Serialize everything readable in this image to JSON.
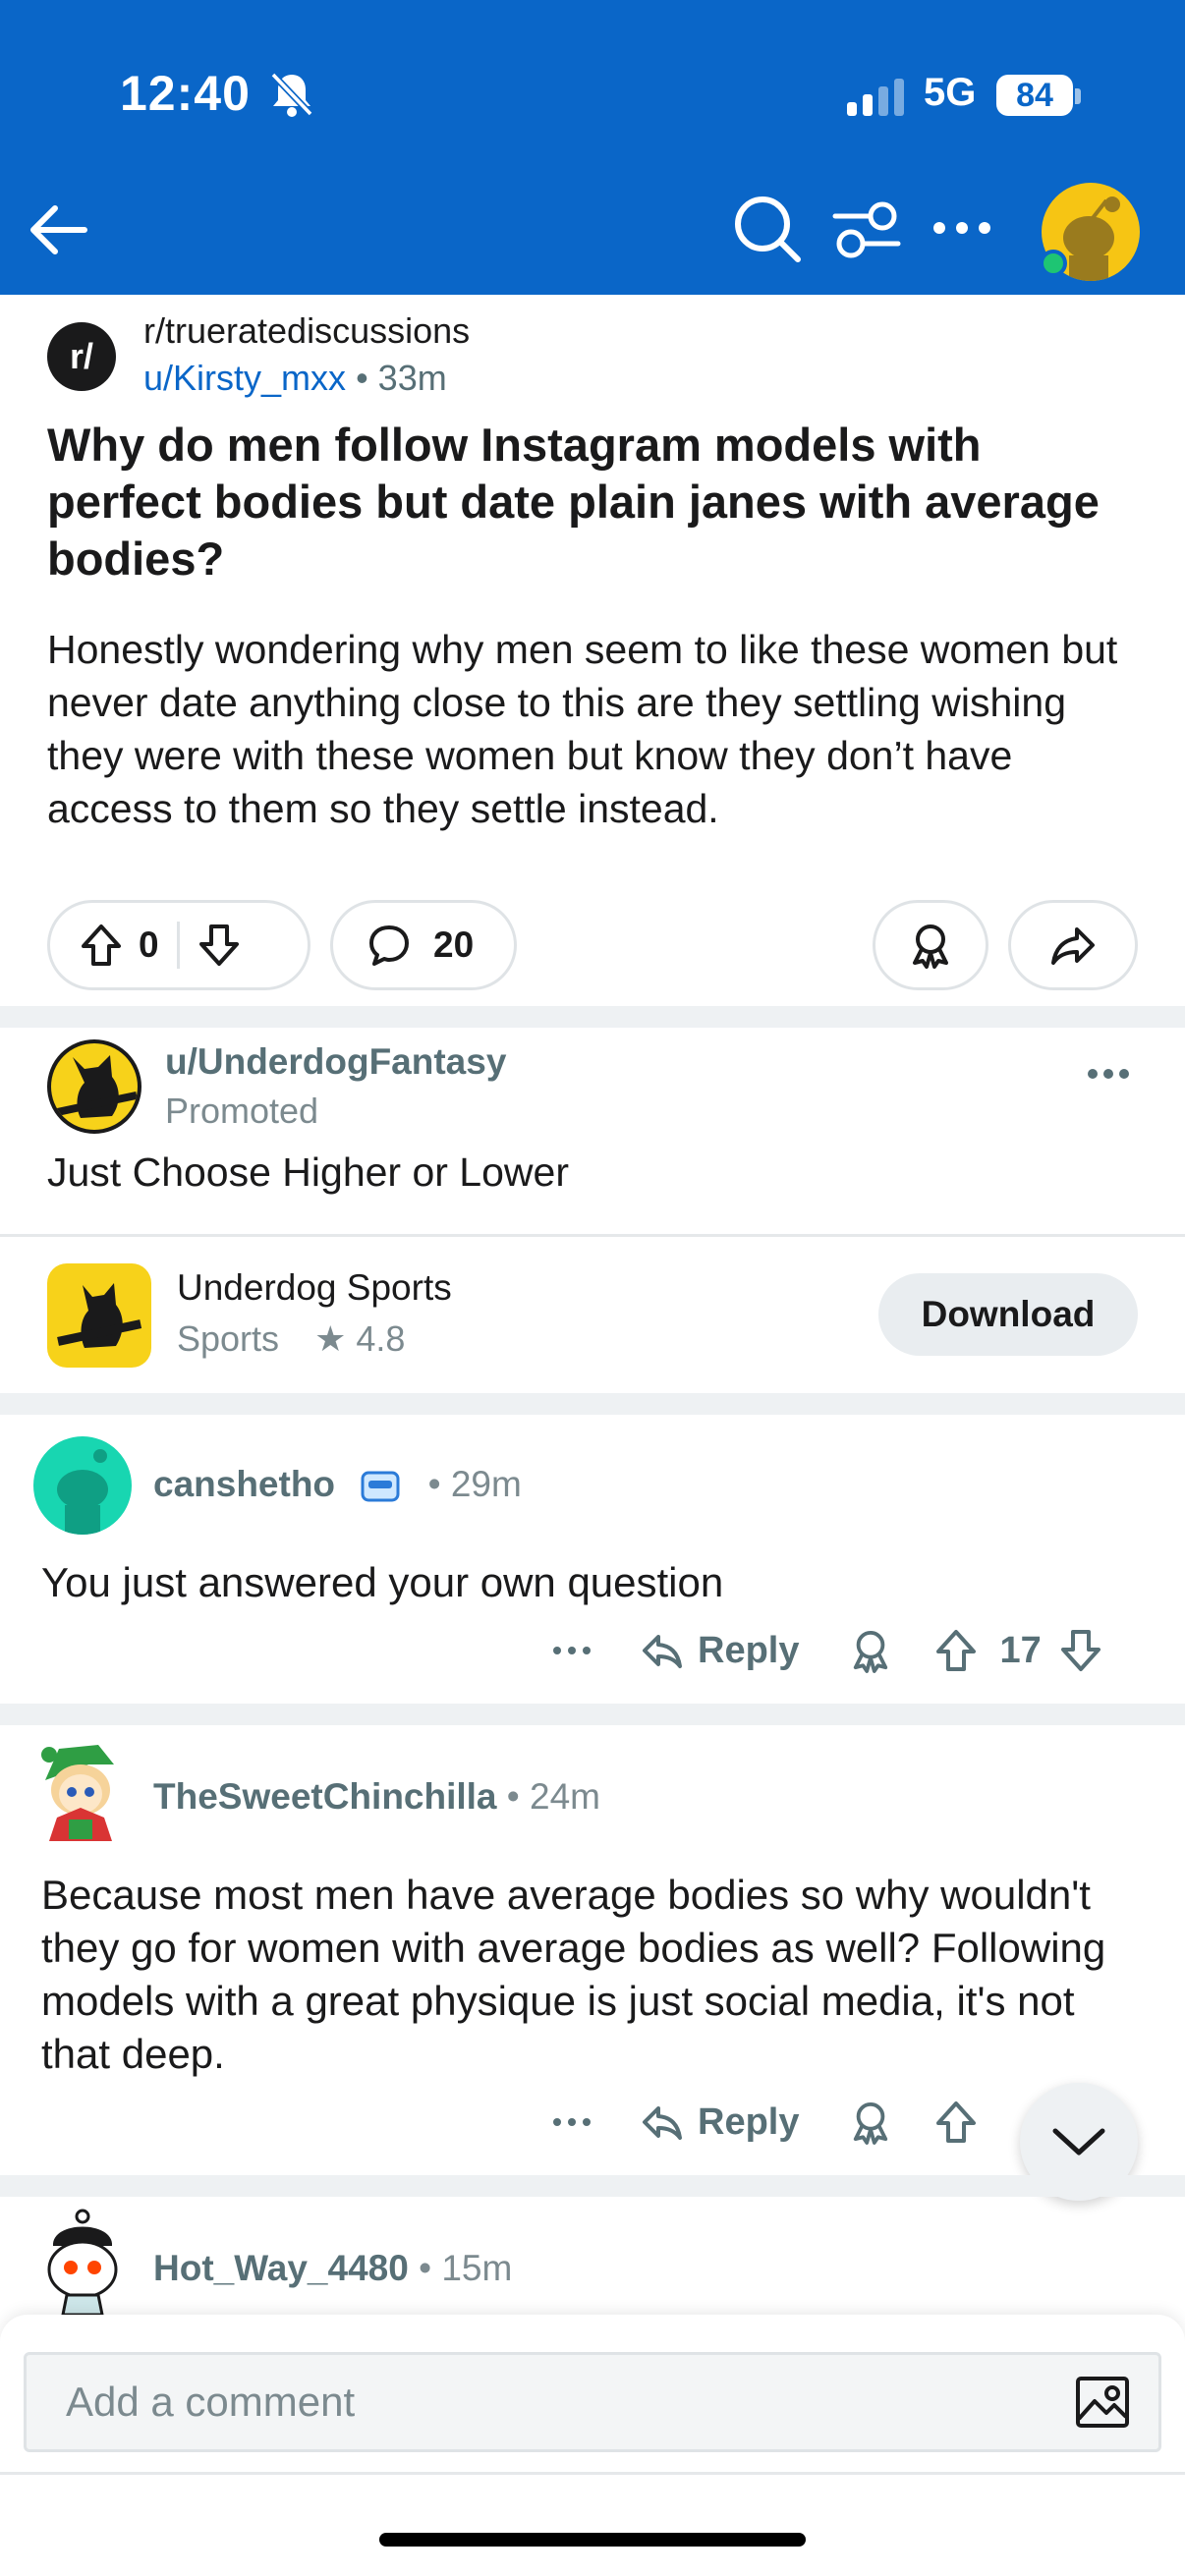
{
  "status_bar": {
    "time": "12:40",
    "network": "5G",
    "battery": "84"
  },
  "colors": {
    "brand_blue": "#0a66c8",
    "meta_gray": "#576f76"
  },
  "post": {
    "subreddit": "r/trueratediscussions",
    "subreddit_logo": "r/",
    "author": "u/Kirsty_mxx",
    "time": "33m",
    "title": "Why do men follow Instagram models with perfect bodies but date plain janes with average bodies?",
    "body": "Honestly wondering why men seem to like these women but never date anything close to this are they settling wishing they were with these women but know they don’t have access to them so they settle instead.",
    "score": "0",
    "comments": "20"
  },
  "ad": {
    "user": "u/UnderdogFantasy",
    "label": "Promoted",
    "text": "Just Choose Higher or Lower",
    "app_name": "Underdog Sports",
    "app_category": "Sports",
    "app_rating": "★ 4.8",
    "cta": "Download"
  },
  "comments": [
    {
      "user": "canshetho",
      "time": "29m",
      "body": "You just answered your own question",
      "reply": "Reply",
      "score": "17"
    },
    {
      "user": "TheSweetChinchilla",
      "time": "24m",
      "body": "Because most men have average bodies so why wouldn't they go for women with average bodies as well? Following models with a great physique is just social media, it's not that deep.",
      "reply": "Reply"
    },
    {
      "user": "Hot_Way_4480",
      "time": "15m"
    }
  ],
  "composer": {
    "placeholder": "Add a comment"
  },
  "icons": [
    "bell-slash-icon",
    "back-arrow-icon",
    "search-icon",
    "filter-icon",
    "more-icon",
    "upvote-icon",
    "downvote-icon",
    "comment-icon",
    "award-icon",
    "share-icon",
    "reply-icon",
    "chevron-down-icon",
    "image-icon"
  ]
}
